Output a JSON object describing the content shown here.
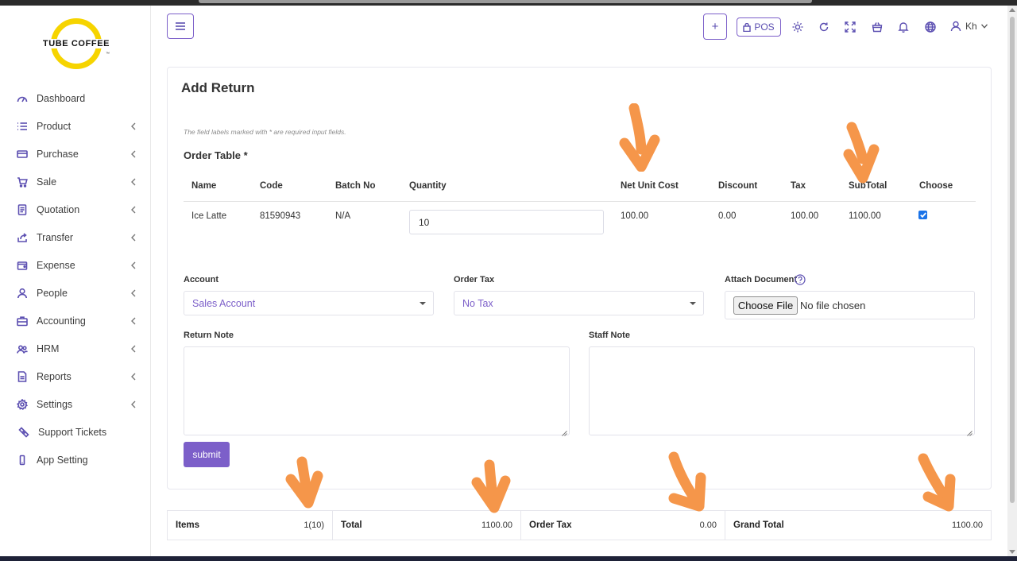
{
  "brand": {
    "logo_text": "TUBE COFFEE",
    "tm": "™",
    "accent": "#7c5fc9",
    "logo_ring_color": "#f6d400"
  },
  "sidebar": {
    "items": [
      {
        "label": "Dashboard",
        "icon": "gauge-icon",
        "has_chevron": false
      },
      {
        "label": "Product",
        "icon": "list-icon",
        "has_chevron": true
      },
      {
        "label": "Purchase",
        "icon": "card-icon",
        "has_chevron": true
      },
      {
        "label": "Sale",
        "icon": "cart-icon",
        "has_chevron": true
      },
      {
        "label": "Quotation",
        "icon": "document-icon",
        "has_chevron": true
      },
      {
        "label": "Transfer",
        "icon": "share-icon",
        "has_chevron": true
      },
      {
        "label": "Expense",
        "icon": "wallet-icon",
        "has_chevron": true
      },
      {
        "label": "People",
        "icon": "user-icon",
        "has_chevron": true
      },
      {
        "label": "Accounting",
        "icon": "briefcase-icon",
        "has_chevron": true
      },
      {
        "label": "HRM",
        "icon": "users-icon",
        "has_chevron": true
      },
      {
        "label": "Reports",
        "icon": "report-icon",
        "has_chevron": true
      },
      {
        "label": "Settings",
        "icon": "gear-icon",
        "has_chevron": true
      },
      {
        "label": "Support Tickets",
        "icon": "ticket-icon",
        "has_chevron": false
      },
      {
        "label": "App Setting",
        "icon": "phone-icon",
        "has_chevron": false
      }
    ]
  },
  "header": {
    "plus_label": "+",
    "pos_label": "POS",
    "user_label": "Kh"
  },
  "form": {
    "title": "Add Return",
    "required_note": "The field labels marked with * are required input fields.",
    "order_table_label": "Order Table *",
    "columns": [
      "Name",
      "Code",
      "Batch No",
      "Quantity",
      "Net Unit Cost",
      "Discount",
      "Tax",
      "SubTotal",
      "Choose"
    ],
    "row": {
      "name": "Ice Latte",
      "code": "81590943",
      "batch": "N/A",
      "quantity": "10",
      "net_unit_cost": "100.00",
      "discount": "0.00",
      "tax": "100.00",
      "subtotal": "1100.00",
      "chosen": true
    },
    "account_label": "Account",
    "account_value": "Sales Account",
    "order_tax_label": "Order Tax",
    "order_tax_value": "No Tax",
    "attach_label": "Attach Document",
    "file_button": "Choose File",
    "file_status": "No file chosen",
    "return_note_label": "Return Note",
    "staff_note_label": "Staff Note",
    "submit_label": "submit"
  },
  "totals": [
    {
      "label": "Items",
      "value": "1(10)"
    },
    {
      "label": "Total",
      "value": "1100.00"
    },
    {
      "label": "Order Tax",
      "value": "0.00"
    },
    {
      "label": "Grand Total",
      "value": "1100.00"
    }
  ],
  "annotation_color": "#f5964a"
}
